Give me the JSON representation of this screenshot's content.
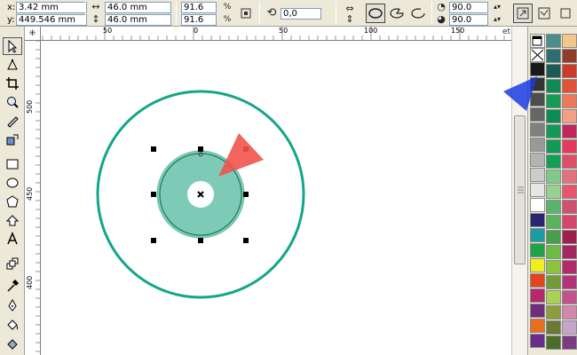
{
  "propbar": {
    "x_label": "x:",
    "x_value": "3.42 mm",
    "y_label": "y:",
    "y_value": "449.546 mm",
    "width_value": "46.0 mm",
    "height_value": "46.0 mm",
    "scale_x": "91.6",
    "scale_y": "91.6",
    "percent": "%",
    "rotation": "0,0",
    "angle_start": "90.0",
    "angle_end": "90.0"
  },
  "rulers": {
    "top_labels": [
      "50",
      "0",
      "50",
      "100",
      "150"
    ],
    "left_labels": [
      "500",
      "450",
      "400"
    ],
    "overflow_text": "etry"
  },
  "palette": {
    "columns": [
      [
        "#ffffff",
        "#ffffff",
        "#1a1a1a",
        "#333333",
        "#4d4d4d",
        "#666666",
        "#808080",
        "#999999",
        "#b3b3b3",
        "#cccccc",
        "#e6e6e6",
        "#ffffff",
        "#2b2470",
        "#1a9da3",
        "#1fa34a",
        "#f0ee1e",
        "#e2451c",
        "#b3286e",
        "#712b7f",
        "#e96d1e",
        "#6b2d8c"
      ],
      [
        "#4a8f8b",
        "#2e6e72",
        "#1d5b55",
        "#0f8a55",
        "#159b55",
        "#0f8a55",
        "#149a56",
        "#129a55",
        "#11a055",
        "#7fca8a",
        "#98d293",
        "#5ab46c",
        "#57b35d",
        "#489f4b",
        "#6bbb45",
        "#8bc540",
        "#6f9d38",
        "#a9d255",
        "#8e9d3b",
        "#6b7a33",
        "#4c6d2b"
      ],
      [
        "#f3c68a",
        "#8e3c2c",
        "#cc3b2a",
        "#e0523a",
        "#ee7a5c",
        "#f2a085",
        "#c4245c",
        "#e33a5e",
        "#e04c6a",
        "#e3727f",
        "#e8546e",
        "#d15070",
        "#d7456c",
        "#a01f4e",
        "#a4285f",
        "#b4286c",
        "#b33379",
        "#c4518c",
        "#d387ad",
        "#c3a6c8",
        "#7b3c82"
      ]
    ]
  }
}
